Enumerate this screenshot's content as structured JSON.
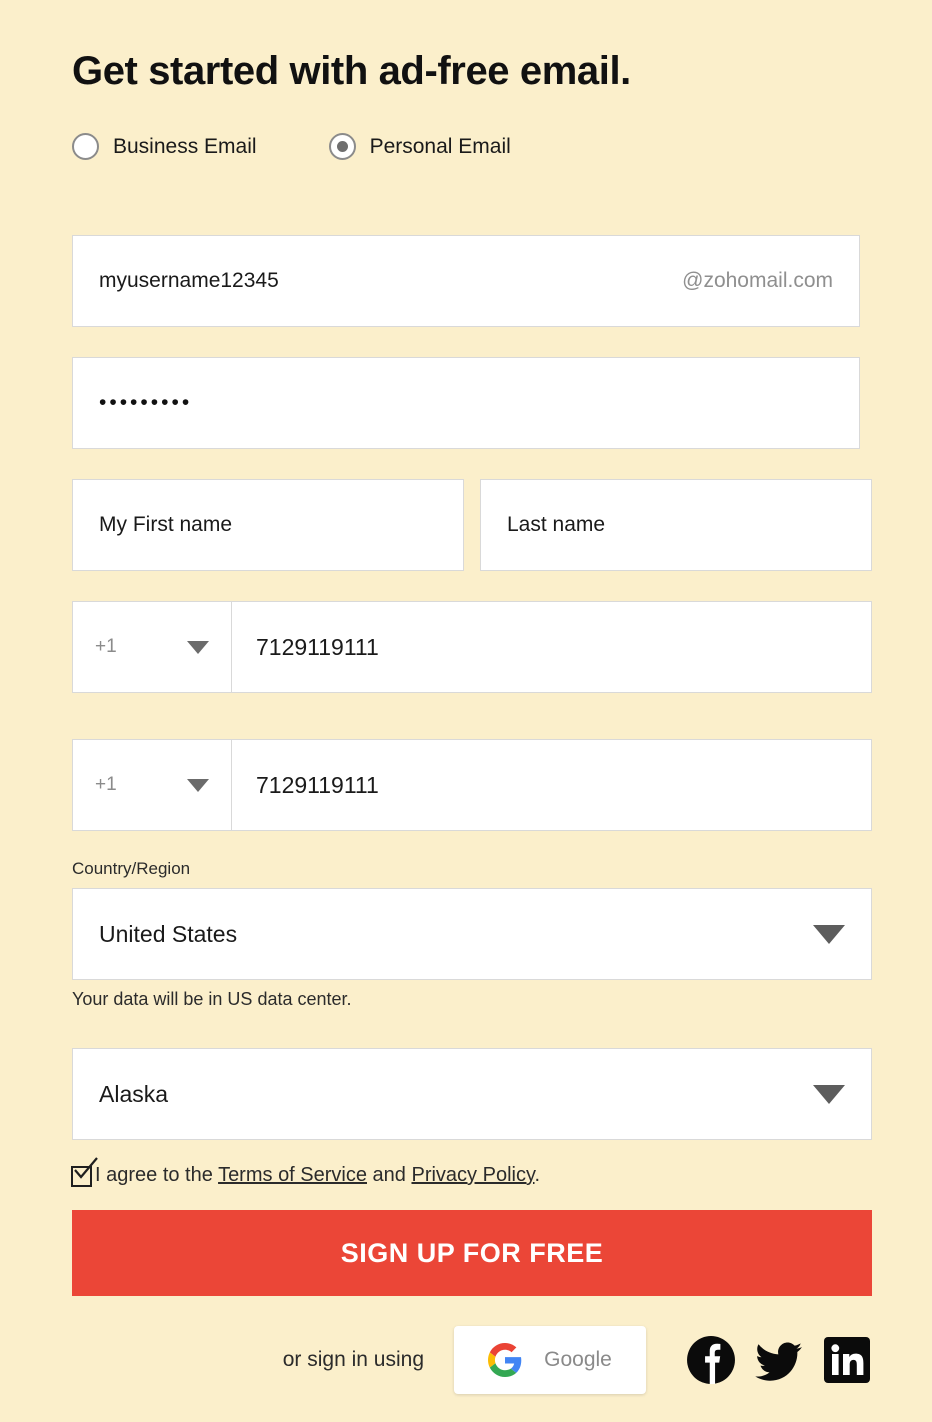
{
  "heading": "Get started with ad-free email.",
  "account_type": {
    "options": [
      {
        "label": "Business Email",
        "selected": false
      },
      {
        "label": "Personal Email",
        "selected": true
      }
    ]
  },
  "form": {
    "username": {
      "value": "myusername12345",
      "domain_suffix": "@zohomail.com"
    },
    "password": {
      "value": "•••••••••"
    },
    "first_name": {
      "value": "My First name"
    },
    "last_name": {
      "value": "Last name"
    },
    "phone_primary": {
      "country_code": "+1",
      "number": "7129119111"
    },
    "phone_secondary": {
      "country_code": "+1",
      "number": "7129119111"
    },
    "country": {
      "label": "Country/Region",
      "value": "United States",
      "note": "Your data will be in US data center."
    },
    "state": {
      "value": "Alaska"
    },
    "terms": {
      "prefix": "I agree to the ",
      "terms_link": "Terms of Service",
      "middle": " and ",
      "privacy_link": "Privacy Policy",
      "suffix": ".",
      "checked": true
    }
  },
  "submit": {
    "label": "SIGN UP FOR FREE",
    "color": "#EB4637"
  },
  "social": {
    "label": "or sign in using",
    "google_label": "Google",
    "providers": [
      "google",
      "facebook",
      "twitter",
      "linkedin"
    ]
  },
  "theme": {
    "background": "#FBEFCB",
    "field_background": "#FFFFFF",
    "field_border": "#D9D9D9",
    "accent": "#EB4637",
    "muted_text": "#8F8F8F"
  }
}
